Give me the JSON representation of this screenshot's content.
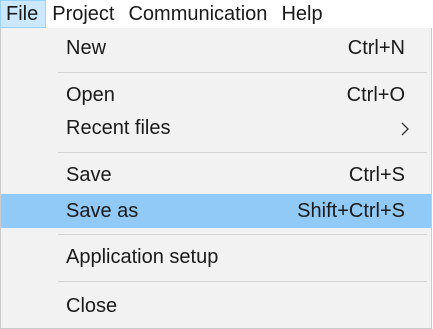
{
  "menubar": {
    "items": [
      {
        "label": "File",
        "active": true
      },
      {
        "label": "Project",
        "active": false
      },
      {
        "label": "Communication",
        "active": false
      },
      {
        "label": "Help",
        "active": false
      }
    ]
  },
  "file_menu": {
    "items": [
      {
        "label": "New",
        "shortcut": "Ctrl+N"
      },
      {
        "label": "Open",
        "shortcut": "Ctrl+O"
      },
      {
        "label": "Recent files",
        "shortcut": "",
        "has_submenu": true
      },
      {
        "label": "Save",
        "shortcut": "Ctrl+S"
      },
      {
        "label": "Save as",
        "shortcut": "Shift+Ctrl+S",
        "highlighted": true
      },
      {
        "label": "Application setup",
        "shortcut": ""
      },
      {
        "label": "Close",
        "shortcut": ""
      }
    ]
  },
  "colors": {
    "menubar_active_bg": "#cce8ff",
    "menubar_active_border": "#99d1ff",
    "menu_bg": "#f2f2f2",
    "menu_highlight_bg": "#91c9f7",
    "separator": "#d4d4d4"
  },
  "icons": {
    "submenu_arrow": "chevron-right-icon"
  }
}
